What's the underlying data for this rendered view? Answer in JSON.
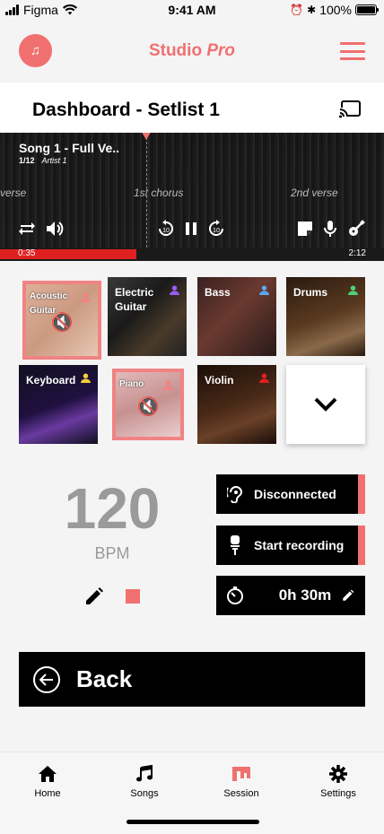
{
  "status_bar": {
    "carrier": "Figma",
    "time": "9:41 AM",
    "battery": "100%"
  },
  "app": {
    "title_main": "Studio ",
    "title_accent": "Pro",
    "accent_color": "#f07070"
  },
  "dashboard": {
    "title": "Dashboard - Setlist 1"
  },
  "player": {
    "song_title": "Song 1 - Full Ve..",
    "track_number": "1/12",
    "artist": "Artist 1",
    "markers": [
      "verse",
      "1st chorus",
      "2nd verse"
    ],
    "elapsed": "0:35",
    "duration": "2:12",
    "progress": 0.355
  },
  "instruments": [
    {
      "name": "Acoustic Guitar",
      "muted": true,
      "user_color": "#f07070"
    },
    {
      "name": "Electric Guitar",
      "muted": false,
      "user_color": "#9b5cf0"
    },
    {
      "name": "Bass",
      "muted": false,
      "user_color": "#5aa8f0"
    },
    {
      "name": "Drums",
      "muted": false,
      "user_color": "#4fd07a"
    },
    {
      "name": "Keyboard",
      "muted": false,
      "user_color": "#f0d040"
    },
    {
      "name": "Piano",
      "muted": true,
      "user_color": "#f07070"
    },
    {
      "name": "Violin",
      "muted": false,
      "user_color": "#e02020"
    }
  ],
  "bpm": {
    "value": "120",
    "label": "BPM"
  },
  "actions": {
    "connection": "Disconnected",
    "record": "Start recording",
    "timer": "0h 30m"
  },
  "back_label": "Back",
  "tabs": [
    {
      "label": "Home",
      "icon": "home-icon"
    },
    {
      "label": "Songs",
      "icon": "music-note-icon"
    },
    {
      "label": "Session",
      "icon": "session-icon",
      "active": true
    },
    {
      "label": "Settings",
      "icon": "gear-icon"
    }
  ]
}
